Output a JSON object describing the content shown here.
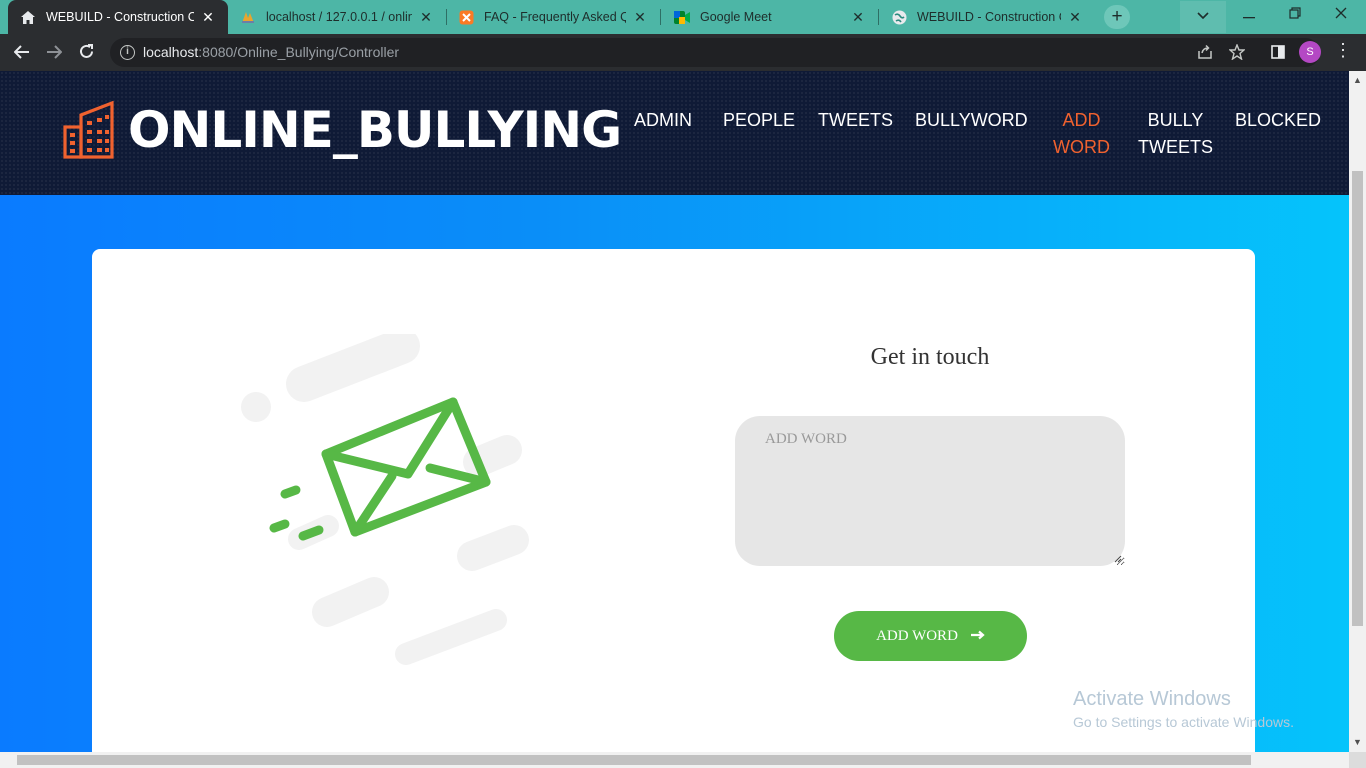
{
  "browser": {
    "tabs": [
      {
        "title": "WEBUILD - Construction Con",
        "favicon": "house-icon",
        "active": true
      },
      {
        "title": "localhost / 127.0.0.1 / online",
        "favicon": "phpmyadmin-icon",
        "active": false
      },
      {
        "title": "FAQ - Frequently Asked Que",
        "favicon": "xampp-icon",
        "active": false
      },
      {
        "title": "Google Meet",
        "favicon": "google-meet-icon",
        "active": false
      },
      {
        "title": "WEBUILD - Construction Con",
        "favicon": "globe-icon",
        "active": false
      }
    ],
    "url_host": "localhost",
    "url_path": ":8080/Online_Bullying/Controller",
    "profile_initial": "S"
  },
  "site": {
    "logo_text": "ONLINE_BULLYING",
    "nav": [
      {
        "line1": "ADMIN",
        "line2": ""
      },
      {
        "line1": "PEOPLE",
        "line2": ""
      },
      {
        "line1": "TWEETS",
        "line2": ""
      },
      {
        "line1": "BULLYWORD",
        "line2": ""
      },
      {
        "line1": "ADD",
        "line2": "WORD"
      },
      {
        "line1": "BULLY",
        "line2": "TWEETS"
      },
      {
        "line1": "BLOCKED",
        "line2": ""
      }
    ],
    "active_nav": "ADD WORD",
    "accent_color": "#f0622f"
  },
  "form": {
    "title": "Get in touch",
    "placeholder": "ADD WORD",
    "value": "",
    "button_label": "ADD WORD",
    "button_color": "#57b846"
  },
  "watermark": {
    "line1": "Activate Windows",
    "line2": "Go to Settings to activate Windows."
  }
}
